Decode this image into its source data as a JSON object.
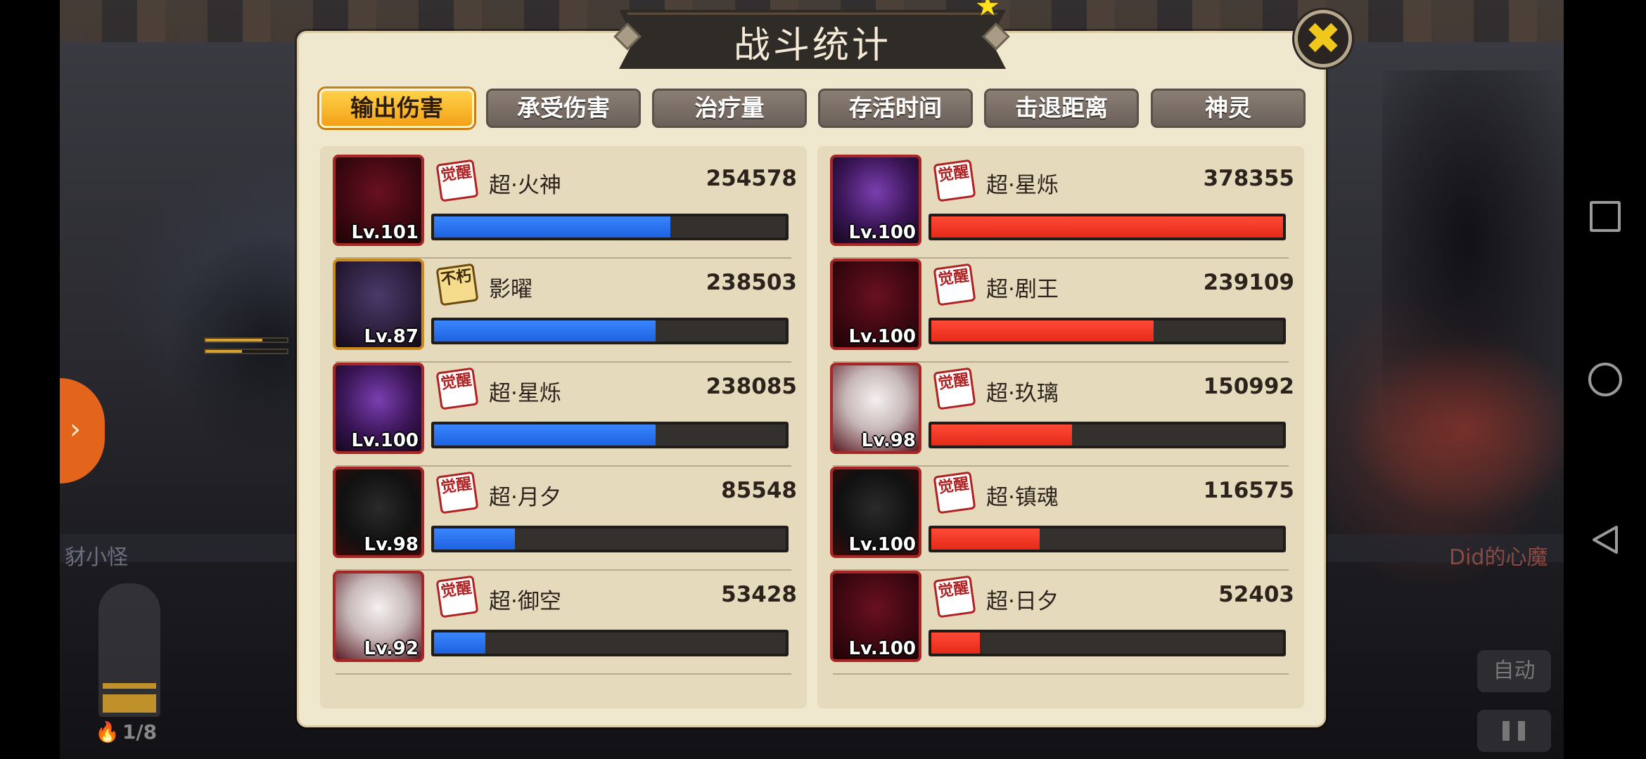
{
  "game": {
    "left_player_name": "豺小怪",
    "enemy_name": "Did的心魔",
    "energy_count": "1/8",
    "auto_label": "自动"
  },
  "dialog": {
    "title": "战斗统计",
    "close_icon": "close-icon"
  },
  "tabs": [
    {
      "label": "输出伤害",
      "active": true
    },
    {
      "label": "承受伤害",
      "active": false
    },
    {
      "label": "治疗量",
      "active": false
    },
    {
      "label": "存活时间",
      "active": false
    },
    {
      "label": "击退距离",
      "active": false
    },
    {
      "label": "神灵",
      "active": false
    }
  ],
  "ally": [
    {
      "name": "超·火神",
      "value": "254578",
      "level": "Lv.101",
      "badge": "觉醒",
      "bar_fraction": 0.672
    },
    {
      "name": "影曜",
      "value": "238503",
      "level": "Lv.87",
      "badge": "不朽",
      "bar_fraction": 0.63
    },
    {
      "name": "超·星烁",
      "value": "238085",
      "level": "Lv.100",
      "badge": "觉醒",
      "bar_fraction": 0.63
    },
    {
      "name": "超·月夕",
      "value": "85548",
      "level": "Lv.98",
      "badge": "觉醒",
      "bar_fraction": 0.23
    },
    {
      "name": "超·御空",
      "value": "53428",
      "level": "Lv.92",
      "badge": "觉醒",
      "bar_fraction": 0.145
    }
  ],
  "enemy": [
    {
      "name": "超·星烁",
      "value": "378355",
      "level": "Lv.100",
      "badge": "觉醒",
      "bar_fraction": 1.0
    },
    {
      "name": "超·剧王",
      "value": "239109",
      "level": "Lv.100",
      "badge": "觉醒",
      "bar_fraction": 0.632
    },
    {
      "name": "超·玖璃",
      "value": "150992",
      "level": "Lv.98",
      "badge": "觉醒",
      "bar_fraction": 0.399
    },
    {
      "name": "超·镇魂",
      "value": "116575",
      "level": "Lv.100",
      "badge": "觉醒",
      "bar_fraction": 0.308
    },
    {
      "name": "超·日夕",
      "value": "52403",
      "level": "Lv.100",
      "badge": "觉醒",
      "bar_fraction": 0.138
    }
  ],
  "colors": {
    "ally_bar": "#2a74f5",
    "enemy_bar": "#f0321f",
    "tab_active": "#f7b322"
  }
}
